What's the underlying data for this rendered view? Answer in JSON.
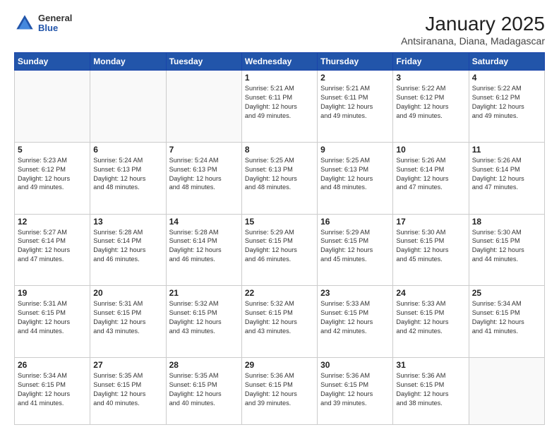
{
  "header": {
    "logo_line1": "General",
    "logo_line2": "Blue",
    "title": "January 2025",
    "subtitle": "Antsiranana, Diana, Madagascar"
  },
  "days_of_week": [
    "Sunday",
    "Monday",
    "Tuesday",
    "Wednesday",
    "Thursday",
    "Friday",
    "Saturday"
  ],
  "weeks": [
    [
      {
        "num": "",
        "info": ""
      },
      {
        "num": "",
        "info": ""
      },
      {
        "num": "",
        "info": ""
      },
      {
        "num": "1",
        "info": "Sunrise: 5:21 AM\nSunset: 6:11 PM\nDaylight: 12 hours\nand 49 minutes."
      },
      {
        "num": "2",
        "info": "Sunrise: 5:21 AM\nSunset: 6:11 PM\nDaylight: 12 hours\nand 49 minutes."
      },
      {
        "num": "3",
        "info": "Sunrise: 5:22 AM\nSunset: 6:12 PM\nDaylight: 12 hours\nand 49 minutes."
      },
      {
        "num": "4",
        "info": "Sunrise: 5:22 AM\nSunset: 6:12 PM\nDaylight: 12 hours\nand 49 minutes."
      }
    ],
    [
      {
        "num": "5",
        "info": "Sunrise: 5:23 AM\nSunset: 6:12 PM\nDaylight: 12 hours\nand 49 minutes."
      },
      {
        "num": "6",
        "info": "Sunrise: 5:24 AM\nSunset: 6:13 PM\nDaylight: 12 hours\nand 48 minutes."
      },
      {
        "num": "7",
        "info": "Sunrise: 5:24 AM\nSunset: 6:13 PM\nDaylight: 12 hours\nand 48 minutes."
      },
      {
        "num": "8",
        "info": "Sunrise: 5:25 AM\nSunset: 6:13 PM\nDaylight: 12 hours\nand 48 minutes."
      },
      {
        "num": "9",
        "info": "Sunrise: 5:25 AM\nSunset: 6:13 PM\nDaylight: 12 hours\nand 48 minutes."
      },
      {
        "num": "10",
        "info": "Sunrise: 5:26 AM\nSunset: 6:14 PM\nDaylight: 12 hours\nand 47 minutes."
      },
      {
        "num": "11",
        "info": "Sunrise: 5:26 AM\nSunset: 6:14 PM\nDaylight: 12 hours\nand 47 minutes."
      }
    ],
    [
      {
        "num": "12",
        "info": "Sunrise: 5:27 AM\nSunset: 6:14 PM\nDaylight: 12 hours\nand 47 minutes."
      },
      {
        "num": "13",
        "info": "Sunrise: 5:28 AM\nSunset: 6:14 PM\nDaylight: 12 hours\nand 46 minutes."
      },
      {
        "num": "14",
        "info": "Sunrise: 5:28 AM\nSunset: 6:14 PM\nDaylight: 12 hours\nand 46 minutes."
      },
      {
        "num": "15",
        "info": "Sunrise: 5:29 AM\nSunset: 6:15 PM\nDaylight: 12 hours\nand 46 minutes."
      },
      {
        "num": "16",
        "info": "Sunrise: 5:29 AM\nSunset: 6:15 PM\nDaylight: 12 hours\nand 45 minutes."
      },
      {
        "num": "17",
        "info": "Sunrise: 5:30 AM\nSunset: 6:15 PM\nDaylight: 12 hours\nand 45 minutes."
      },
      {
        "num": "18",
        "info": "Sunrise: 5:30 AM\nSunset: 6:15 PM\nDaylight: 12 hours\nand 44 minutes."
      }
    ],
    [
      {
        "num": "19",
        "info": "Sunrise: 5:31 AM\nSunset: 6:15 PM\nDaylight: 12 hours\nand 44 minutes."
      },
      {
        "num": "20",
        "info": "Sunrise: 5:31 AM\nSunset: 6:15 PM\nDaylight: 12 hours\nand 43 minutes."
      },
      {
        "num": "21",
        "info": "Sunrise: 5:32 AM\nSunset: 6:15 PM\nDaylight: 12 hours\nand 43 minutes."
      },
      {
        "num": "22",
        "info": "Sunrise: 5:32 AM\nSunset: 6:15 PM\nDaylight: 12 hours\nand 43 minutes."
      },
      {
        "num": "23",
        "info": "Sunrise: 5:33 AM\nSunset: 6:15 PM\nDaylight: 12 hours\nand 42 minutes."
      },
      {
        "num": "24",
        "info": "Sunrise: 5:33 AM\nSunset: 6:15 PM\nDaylight: 12 hours\nand 42 minutes."
      },
      {
        "num": "25",
        "info": "Sunrise: 5:34 AM\nSunset: 6:15 PM\nDaylight: 12 hours\nand 41 minutes."
      }
    ],
    [
      {
        "num": "26",
        "info": "Sunrise: 5:34 AM\nSunset: 6:15 PM\nDaylight: 12 hours\nand 41 minutes."
      },
      {
        "num": "27",
        "info": "Sunrise: 5:35 AM\nSunset: 6:15 PM\nDaylight: 12 hours\nand 40 minutes."
      },
      {
        "num": "28",
        "info": "Sunrise: 5:35 AM\nSunset: 6:15 PM\nDaylight: 12 hours\nand 40 minutes."
      },
      {
        "num": "29",
        "info": "Sunrise: 5:36 AM\nSunset: 6:15 PM\nDaylight: 12 hours\nand 39 minutes."
      },
      {
        "num": "30",
        "info": "Sunrise: 5:36 AM\nSunset: 6:15 PM\nDaylight: 12 hours\nand 39 minutes."
      },
      {
        "num": "31",
        "info": "Sunrise: 5:36 AM\nSunset: 6:15 PM\nDaylight: 12 hours\nand 38 minutes."
      },
      {
        "num": "",
        "info": ""
      }
    ]
  ]
}
